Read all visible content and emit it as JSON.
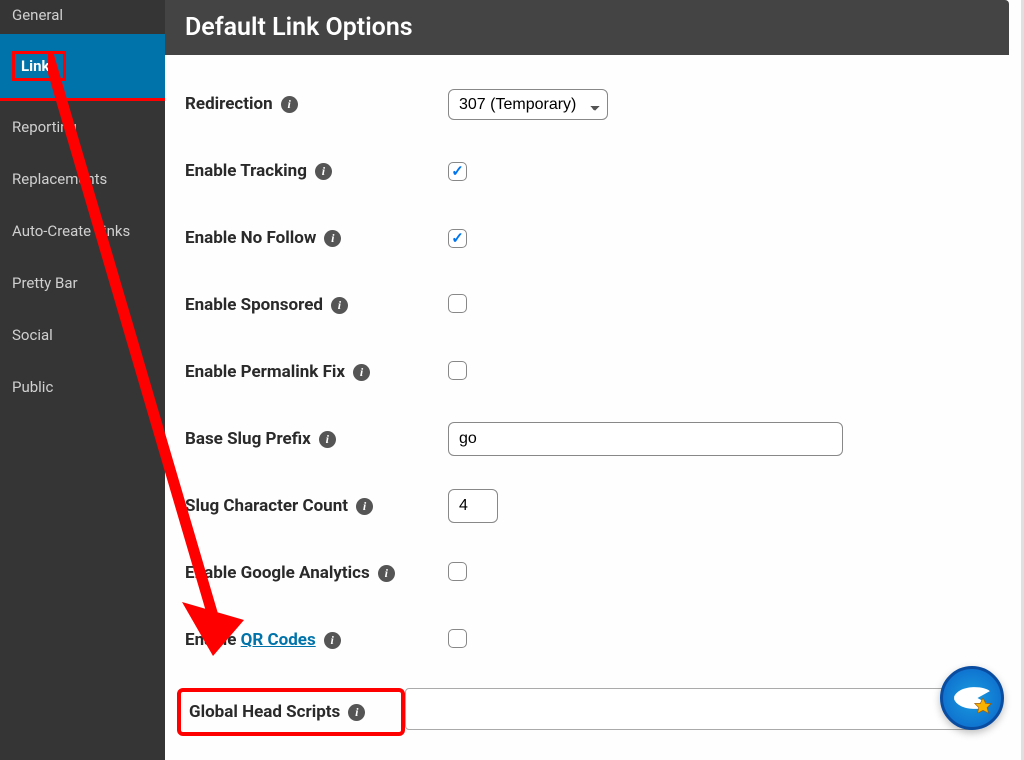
{
  "sidebar": {
    "items": [
      {
        "label": "General"
      },
      {
        "label": "Links"
      },
      {
        "label": "Reporting"
      },
      {
        "label": "Replacements"
      },
      {
        "label": "Auto-Create Links"
      },
      {
        "label": "Pretty Bar"
      },
      {
        "label": "Social"
      },
      {
        "label": "Public"
      }
    ],
    "active_index": 1
  },
  "header": {
    "title": "Default Link Options"
  },
  "form": {
    "redirection": {
      "label": "Redirection",
      "value": "307 (Temporary)"
    },
    "tracking": {
      "label": "Enable Tracking",
      "checked": true
    },
    "nofollow": {
      "label": "Enable No Follow",
      "checked": true
    },
    "sponsored": {
      "label": "Enable Sponsored",
      "checked": false
    },
    "permalink": {
      "label": "Enable Permalink Fix",
      "checked": false
    },
    "slug_prefix": {
      "label": "Base Slug Prefix",
      "value": "go"
    },
    "slug_count": {
      "label": "Slug Character Count",
      "value": "4"
    },
    "ga": {
      "label": "Enable Google Analytics",
      "checked": false
    },
    "qr": {
      "label_prefix": "Enable ",
      "link_text": "QR Codes",
      "checked": false
    },
    "head_scripts": {
      "label": "Global Head Scripts",
      "value": ""
    }
  }
}
